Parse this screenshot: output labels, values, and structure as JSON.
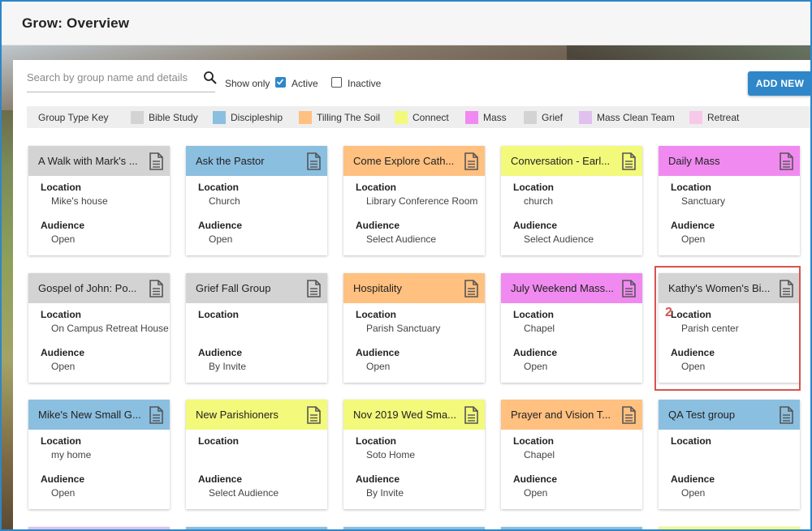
{
  "app": {
    "title": "Grow: Overview"
  },
  "topbar_icons": [
    "chat-icon",
    "settings-icon",
    "help-icon",
    "account-icon"
  ],
  "toolbar": {
    "search_placeholder": "Search by group name and details",
    "show_only_label": "Show only",
    "active_label": "Active",
    "active_checked": true,
    "inactive_label": "Inactive",
    "inactive_checked": false,
    "add_new_label": "ADD NEW"
  },
  "group_type_key": {
    "title": "Group Type Key",
    "items": [
      {
        "label": "Bible Study",
        "color": "#d3d3d3"
      },
      {
        "label": "Discipleship",
        "color": "#8bbfe0"
      },
      {
        "label": "Tilling The Soil",
        "color": "#ffc080"
      },
      {
        "label": "Connect",
        "color": "#f3f97a"
      },
      {
        "label": "Mass",
        "color": "#f08af0"
      },
      {
        "label": "Grief",
        "color": "#d3d3d3"
      },
      {
        "label": "Mass Clean Team",
        "color": "#e0c0ee"
      },
      {
        "label": "Retreat",
        "color": "#f8c8e8"
      }
    ]
  },
  "labels": {
    "location": "Location",
    "audience": "Audience"
  },
  "callout_number": "2",
  "cards": [
    {
      "title": "A Walk with Mark's ...",
      "color": "#d3d3d3",
      "location": "Mike's house",
      "audience": "Open"
    },
    {
      "title": "Ask the Pastor",
      "color": "#8bbfe0",
      "location": "Church",
      "audience": "Open"
    },
    {
      "title": "Come Explore Cath...",
      "color": "#ffc080",
      "location": "Library Conference Room",
      "audience": "Select Audience"
    },
    {
      "title": "Conversation - Earl...",
      "color": "#f3f97a",
      "location": "church",
      "audience": "Select Audience"
    },
    {
      "title": "Daily Mass",
      "color": "#f08af0",
      "location": "Sanctuary",
      "audience": "Open"
    },
    {
      "title": "Gospel of John: Po...",
      "color": "#d3d3d3",
      "location": "On Campus Retreat House",
      "audience": "Open"
    },
    {
      "title": "Grief Fall Group",
      "color": "#d3d3d3",
      "location": "",
      "audience": "By Invite"
    },
    {
      "title": "Hospitality",
      "color": "#ffc080",
      "location": "Parish Sanctuary",
      "audience": "Open"
    },
    {
      "title": "July Weekend Mass...",
      "color": "#f08af0",
      "location": "Chapel",
      "audience": "Open"
    },
    {
      "title": "Kathy's Women's Bi...",
      "color": "#d3d3d3",
      "location": "Parish center",
      "audience": "Open"
    },
    {
      "title": "Mike's New Small G...",
      "color": "#8bbfe0",
      "location": "my home",
      "audience": "Open"
    },
    {
      "title": "New Parishioners",
      "color": "#f3f97a",
      "location": "",
      "audience": "Select Audience"
    },
    {
      "title": "Nov 2019 Wed Sma...",
      "color": "#f3f97a",
      "location": "Soto Home",
      "audience": "By Invite"
    },
    {
      "title": "Prayer and Vision T...",
      "color": "#ffc080",
      "location": "Chapel",
      "audience": "Open"
    },
    {
      "title": "QA Test group",
      "color": "#8bbfe0",
      "location": "",
      "audience": "Open"
    }
  ],
  "next_row_colors": [
    "#e0c0ee",
    "#8bbfe0",
    "#8bbfe0",
    "#8bbfe0",
    "#f3f97a"
  ]
}
